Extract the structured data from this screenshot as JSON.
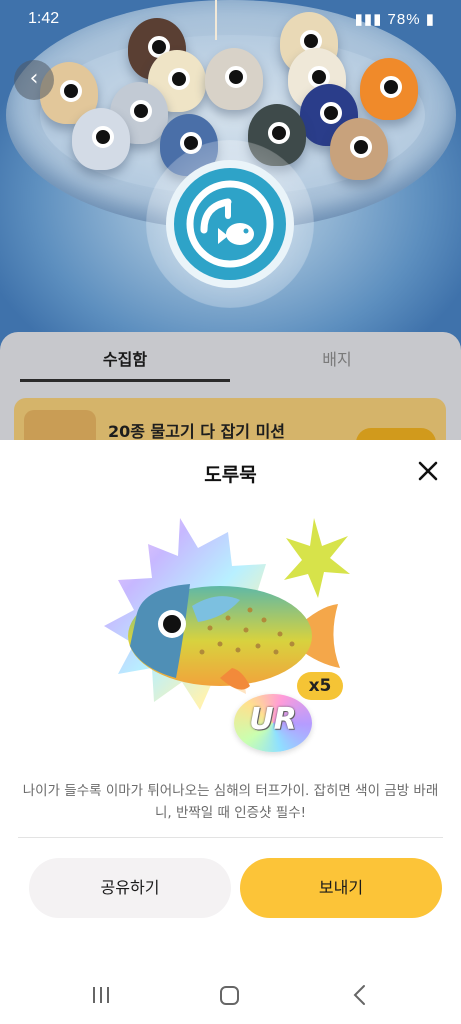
{
  "status_bar": {
    "time": "1:42",
    "battery": "78%"
  },
  "tabs": [
    {
      "label": "수집함",
      "active": true
    },
    {
      "label": "배지",
      "active": false
    }
  ],
  "mission": {
    "title": "20종 물고기 다 잡기 미션"
  },
  "sheet": {
    "title": "도루묵",
    "count": "x5",
    "rarity": "UR",
    "description": "나이가 들수록 이마가 튀어나오는 심해의 터프가이. 잡히면 색이 금방 바래니, 반짝일 때 인증샷 필수!",
    "share_label": "공유하기",
    "send_label": "보내기"
  },
  "colors": {
    "accent": "#fcc438",
    "share_bg": "#f4f2f3",
    "emblem": "#2ea3c8"
  },
  "icons": {
    "back": "chevron-left-icon",
    "close": "close-icon",
    "emblem": "fishing-hook-fish-icon"
  }
}
